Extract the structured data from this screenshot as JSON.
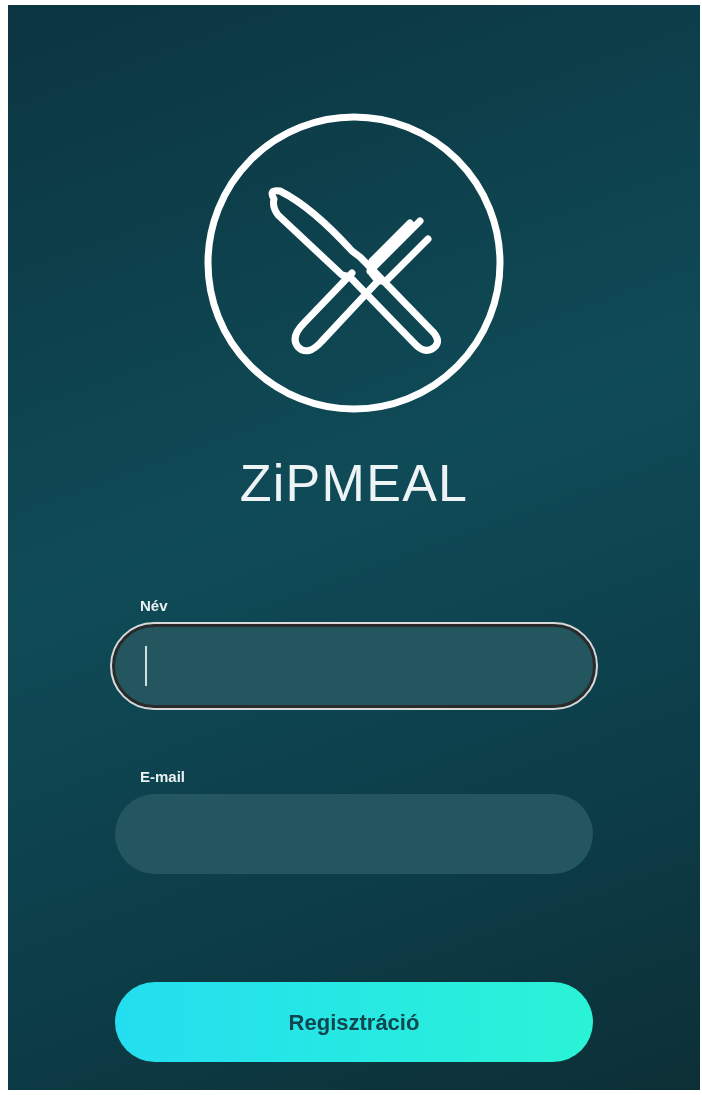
{
  "app": {
    "name": "ZiPMEAL"
  },
  "fields": [
    {
      "label": "Név",
      "focused": true
    },
    {
      "label": "E-mail",
      "focused": false
    }
  ],
  "button": {
    "label": "Regisztráció"
  }
}
